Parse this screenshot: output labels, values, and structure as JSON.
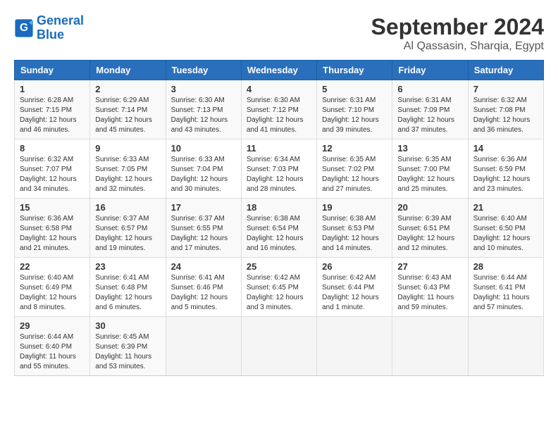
{
  "header": {
    "logo_line1": "General",
    "logo_line2": "Blue",
    "month": "September 2024",
    "location": "Al Qassasin, Sharqia, Egypt"
  },
  "weekdays": [
    "Sunday",
    "Monday",
    "Tuesday",
    "Wednesday",
    "Thursday",
    "Friday",
    "Saturday"
  ],
  "weeks": [
    [
      {
        "day": "1",
        "sunrise": "6:28 AM",
        "sunset": "7:15 PM",
        "daylight": "12 hours and 46 minutes."
      },
      {
        "day": "2",
        "sunrise": "6:29 AM",
        "sunset": "7:14 PM",
        "daylight": "12 hours and 45 minutes."
      },
      {
        "day": "3",
        "sunrise": "6:30 AM",
        "sunset": "7:13 PM",
        "daylight": "12 hours and 43 minutes."
      },
      {
        "day": "4",
        "sunrise": "6:30 AM",
        "sunset": "7:12 PM",
        "daylight": "12 hours and 41 minutes."
      },
      {
        "day": "5",
        "sunrise": "6:31 AM",
        "sunset": "7:10 PM",
        "daylight": "12 hours and 39 minutes."
      },
      {
        "day": "6",
        "sunrise": "6:31 AM",
        "sunset": "7:09 PM",
        "daylight": "12 hours and 37 minutes."
      },
      {
        "day": "7",
        "sunrise": "6:32 AM",
        "sunset": "7:08 PM",
        "daylight": "12 hours and 36 minutes."
      }
    ],
    [
      {
        "day": "8",
        "sunrise": "6:32 AM",
        "sunset": "7:07 PM",
        "daylight": "12 hours and 34 minutes."
      },
      {
        "day": "9",
        "sunrise": "6:33 AM",
        "sunset": "7:05 PM",
        "daylight": "12 hours and 32 minutes."
      },
      {
        "day": "10",
        "sunrise": "6:33 AM",
        "sunset": "7:04 PM",
        "daylight": "12 hours and 30 minutes."
      },
      {
        "day": "11",
        "sunrise": "6:34 AM",
        "sunset": "7:03 PM",
        "daylight": "12 hours and 28 minutes."
      },
      {
        "day": "12",
        "sunrise": "6:35 AM",
        "sunset": "7:02 PM",
        "daylight": "12 hours and 27 minutes."
      },
      {
        "day": "13",
        "sunrise": "6:35 AM",
        "sunset": "7:00 PM",
        "daylight": "12 hours and 25 minutes."
      },
      {
        "day": "14",
        "sunrise": "6:36 AM",
        "sunset": "6:59 PM",
        "daylight": "12 hours and 23 minutes."
      }
    ],
    [
      {
        "day": "15",
        "sunrise": "6:36 AM",
        "sunset": "6:58 PM",
        "daylight": "12 hours and 21 minutes."
      },
      {
        "day": "16",
        "sunrise": "6:37 AM",
        "sunset": "6:57 PM",
        "daylight": "12 hours and 19 minutes."
      },
      {
        "day": "17",
        "sunrise": "6:37 AM",
        "sunset": "6:55 PM",
        "daylight": "12 hours and 17 minutes."
      },
      {
        "day": "18",
        "sunrise": "6:38 AM",
        "sunset": "6:54 PM",
        "daylight": "12 hours and 16 minutes."
      },
      {
        "day": "19",
        "sunrise": "6:38 AM",
        "sunset": "6:53 PM",
        "daylight": "12 hours and 14 minutes."
      },
      {
        "day": "20",
        "sunrise": "6:39 AM",
        "sunset": "6:51 PM",
        "daylight": "12 hours and 12 minutes."
      },
      {
        "day": "21",
        "sunrise": "6:40 AM",
        "sunset": "6:50 PM",
        "daylight": "12 hours and 10 minutes."
      }
    ],
    [
      {
        "day": "22",
        "sunrise": "6:40 AM",
        "sunset": "6:49 PM",
        "daylight": "12 hours and 8 minutes."
      },
      {
        "day": "23",
        "sunrise": "6:41 AM",
        "sunset": "6:48 PM",
        "daylight": "12 hours and 6 minutes."
      },
      {
        "day": "24",
        "sunrise": "6:41 AM",
        "sunset": "6:46 PM",
        "daylight": "12 hours and 5 minutes."
      },
      {
        "day": "25",
        "sunrise": "6:42 AM",
        "sunset": "6:45 PM",
        "daylight": "12 hours and 3 minutes."
      },
      {
        "day": "26",
        "sunrise": "6:42 AM",
        "sunset": "6:44 PM",
        "daylight": "12 hours and 1 minute."
      },
      {
        "day": "27",
        "sunrise": "6:43 AM",
        "sunset": "6:43 PM",
        "daylight": "11 hours and 59 minutes."
      },
      {
        "day": "28",
        "sunrise": "6:44 AM",
        "sunset": "6:41 PM",
        "daylight": "11 hours and 57 minutes."
      }
    ],
    [
      {
        "day": "29",
        "sunrise": "6:44 AM",
        "sunset": "6:40 PM",
        "daylight": "11 hours and 55 minutes."
      },
      {
        "day": "30",
        "sunrise": "6:45 AM",
        "sunset": "6:39 PM",
        "daylight": "11 hours and 53 minutes."
      },
      null,
      null,
      null,
      null,
      null
    ]
  ]
}
